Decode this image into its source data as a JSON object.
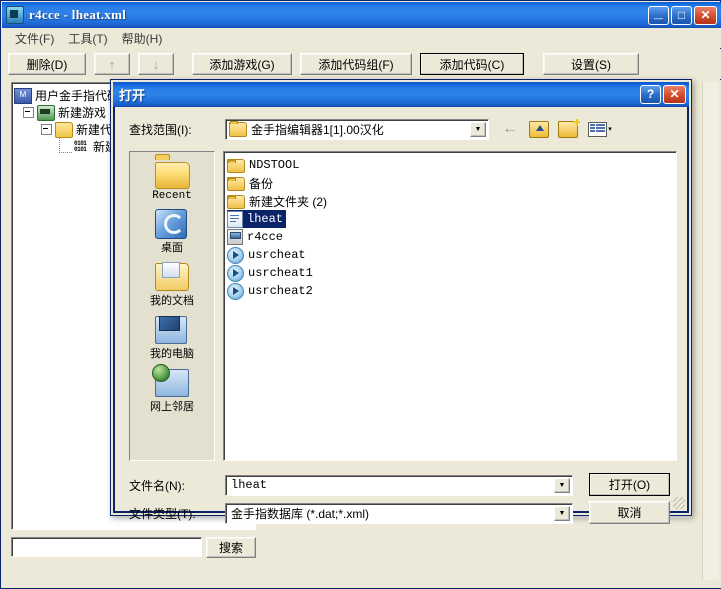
{
  "window": {
    "title": "r4cce - lheat.xml",
    "icon": "app-icon",
    "buttons": {
      "minimize": "_",
      "maximize": "□",
      "close": "✕"
    }
  },
  "menubar": {
    "items": [
      {
        "label": "文件(F)",
        "name": "menu-file"
      },
      {
        "label": "工具(T)",
        "name": "menu-tools"
      },
      {
        "label": "帮助(H)",
        "name": "menu-help"
      }
    ]
  },
  "toolbar": {
    "delete_label": "删除(D)",
    "up_label": "↑",
    "down_label": "↓",
    "add_game_label": "添加游戏(G)",
    "add_code_group_label": "添加代码组(F)",
    "add_code_label": "添加代码(C)",
    "settings_label": "设置(S)"
  },
  "tree": {
    "nodes": [
      {
        "label": "用户金手指代码",
        "icon": "root-icon",
        "level": 0
      },
      {
        "label": "新建游戏",
        "icon": "game-icon",
        "level": 1
      },
      {
        "label": "新建代码组",
        "icon": "folder-icon",
        "level": 2
      },
      {
        "label": "新建代码",
        "icon": "code-icon",
        "level": 3
      }
    ]
  },
  "search": {
    "value": "",
    "button_label": "搜索"
  },
  "dialog": {
    "title": "打开",
    "help_button": "?",
    "close_button": "✕",
    "lookin": {
      "label": "查找范围(I):",
      "value": "金手指编辑器1[1].00汉化",
      "arrow": "▼"
    },
    "nav": {
      "back": "←",
      "up": "up-folder-icon",
      "new_folder": "new-folder-icon",
      "views": "views-icon",
      "views_caret": "▾"
    },
    "places": [
      {
        "label": "Recent",
        "icon": "recent-icon"
      },
      {
        "label": "桌面",
        "icon": "desktop-icon"
      },
      {
        "label": "我的文档",
        "icon": "my-documents-icon"
      },
      {
        "label": "我的电脑",
        "icon": "my-computer-icon"
      },
      {
        "label": "网上邻居",
        "icon": "network-icon"
      }
    ],
    "files": [
      {
        "name": "NDSTOOL",
        "type": "folder",
        "selected": false
      },
      {
        "name": "备份",
        "type": "folder",
        "selected": false
      },
      {
        "name": "新建文件夹 (2)",
        "type": "folder",
        "selected": false
      },
      {
        "name": "lheat",
        "type": "xml",
        "selected": true
      },
      {
        "name": "r4cce",
        "type": "exe",
        "selected": false
      },
      {
        "name": "usrcheat",
        "type": "dat",
        "selected": false
      },
      {
        "name": "usrcheat1",
        "type": "dat",
        "selected": false
      },
      {
        "name": "usrcheat2",
        "type": "dat",
        "selected": false
      }
    ],
    "filename": {
      "label": "文件名(N):",
      "value": "lheat",
      "arrow": "▼"
    },
    "filetype": {
      "label": "文件类型(T):",
      "value": "金手指数据库 (*.dat;*.xml)",
      "arrow": "▼"
    },
    "open_button": "打开(O)",
    "cancel_button": "取消"
  },
  "colors": {
    "titlebar_blue": "#2f82ea",
    "dialog_border": "#0a246a",
    "selection": "#0a246a",
    "face": "#ece9d8"
  }
}
